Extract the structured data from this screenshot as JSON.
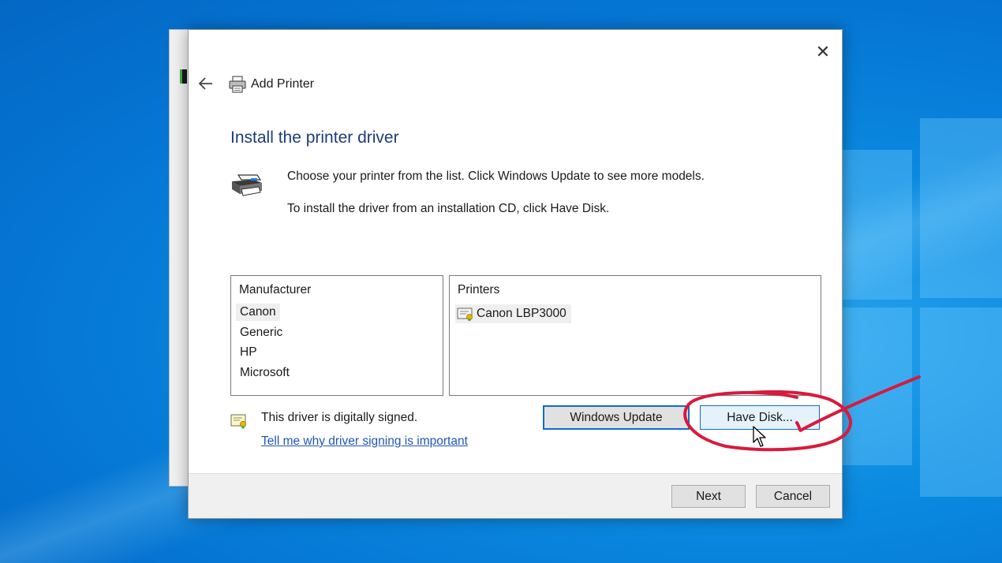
{
  "dialog": {
    "header_title": "Add Printer",
    "page_title": "Install the printer driver",
    "instruction_1": "Choose your printer from the list. Click Windows Update to see more models.",
    "instruction_2": "To install the driver from an installation CD, click Have Disk."
  },
  "manufacturer_list": {
    "header": "Manufacturer",
    "items": [
      "Canon",
      "Generic",
      "HP",
      "Microsoft"
    ],
    "selected": "Canon"
  },
  "printer_list": {
    "header": "Printers",
    "items": [
      "Canon LBP3000"
    ],
    "selected": "Canon LBP3000"
  },
  "signing": {
    "status_text": "This driver is digitally signed.",
    "link_text": "Tell me why driver signing is important"
  },
  "buttons": {
    "windows_update": "Windows Update",
    "have_disk": "Have Disk...",
    "next": "Next",
    "cancel": "Cancel"
  },
  "icons": {
    "close": "close-icon",
    "back": "back-arrow-icon",
    "printer": "printer-icon",
    "certificate": "certificate-icon"
  },
  "colors": {
    "title_blue": "#1c3d7a",
    "link_blue": "#1f56b8",
    "focus_blue": "#0f6cc9",
    "annotation_red": "#d81a3c",
    "desktop_blue": "#0a8ae0"
  }
}
